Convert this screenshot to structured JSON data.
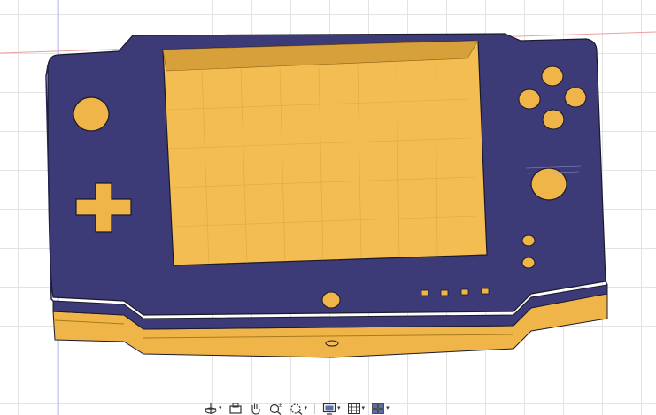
{
  "viewport": {
    "background": "#ffffff",
    "grid_color": "#e3e3e3",
    "axis_x_color": "#e8a0a0",
    "axis_y_color": "#9aa6e6"
  },
  "model": {
    "description_hidden": "",
    "colors": {
      "faceplate": "#3d3a78",
      "faceplate_edge": "#24224e",
      "base_body": "#f0b549",
      "base_edge": "#a77a1d",
      "screen_recess": "#f3bd52",
      "screen_shadow": "#d8a03b",
      "outline": "#1a1a2a"
    },
    "features": [
      "screen-opening",
      "dpad-cutout",
      "left-round-hole",
      "action-button-holes",
      "large-round-hole",
      "start-select-holes",
      "home-button-hole",
      "led-slots",
      "bottom-slot"
    ]
  },
  "toolbar": {
    "buttons": [
      {
        "name": "orbit-tool",
        "icon": "orbit-icon",
        "has_menu": true
      },
      {
        "name": "look-at-tool",
        "icon": "look-at-icon",
        "has_menu": false
      },
      {
        "name": "pan-tool",
        "icon": "pan-hand-icon",
        "has_menu": false
      },
      {
        "name": "zoom-tool",
        "icon": "zoom-icon",
        "has_menu": false
      },
      {
        "name": "fit-tool",
        "icon": "fit-zoom-icon",
        "has_menu": true
      },
      {
        "name": "display-settings",
        "icon": "display-icon",
        "has_menu": true
      },
      {
        "name": "grid-snaps",
        "icon": "grid-icon",
        "has_menu": true
      },
      {
        "name": "viewports",
        "icon": "viewports-icon",
        "has_menu": true
      }
    ],
    "caret": "▾"
  }
}
